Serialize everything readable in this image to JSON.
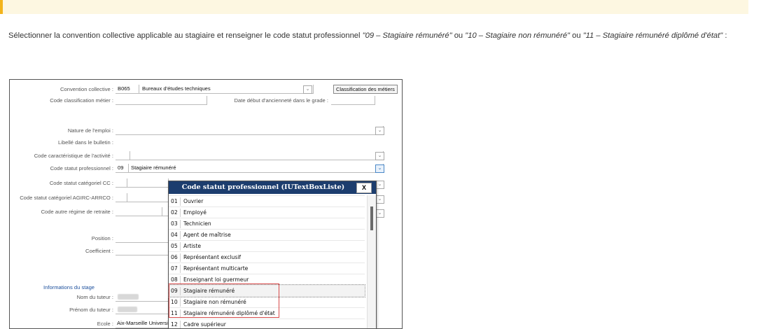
{
  "intro": {
    "part1": "Sélectionner la convention collective applicable au stagiaire et renseigner le code statut professionnel ",
    "q1": "\"09 – Stagiaire rémunéré\"",
    "part2": " ou ",
    "q2": "\"10 – Stagiaire non rémunéré\"",
    "part3": " ou ",
    "q3": "\"11 – Stagiaire rémunéré diplômé d'état\"",
    "part4": " :"
  },
  "form": {
    "convention_label": "Convention collective :",
    "convention_code": "B065",
    "convention_name": "Bureaux d'études techniques",
    "classification_button": "Classification des métiers",
    "code_classification_label": "Code classification métier :",
    "date_debut_label": "Date début d'ancienneté dans le grade :",
    "nature_label": "Nature de l'emploi :",
    "libelle_label": "Libellé dans le bulletin :",
    "code_caracteristique_label": "Code caractéristique de l'activité :",
    "code_statut_label": "Code statut professionnel :",
    "code_statut_code": "09",
    "code_statut_value": "Stagiaire rémunéré",
    "code_statut_cat_label": "Code statut catégoriel CC :",
    "code_statut_agirc_label": "Code statut catégoriel AGIRC-ARRCO :",
    "code_autre_regime_label": "Code autre régime de retraite :",
    "position_label": "Position :",
    "coefficient_label": "Coefficient :",
    "stage_section": "Informations du stage",
    "nom_tuteur_label": "Nom du tuteur :",
    "prenom_tuteur_label": "Prénom du tuteur :",
    "ecole_label": "Ecole :",
    "ecole_value": "Aix-Marseille Universi"
  },
  "popup": {
    "title": "Code statut professionnel (IUTextBoxListe)",
    "close": "X",
    "items": [
      {
        "code": "01",
        "label": "Ouvrier"
      },
      {
        "code": "02",
        "label": "Employé"
      },
      {
        "code": "03",
        "label": "Technicien"
      },
      {
        "code": "04",
        "label": "Agent de maîtrise"
      },
      {
        "code": "05",
        "label": "Artiste"
      },
      {
        "code": "06",
        "label": "Représentant exclusif"
      },
      {
        "code": "07",
        "label": "Représentant multicarte"
      },
      {
        "code": "08",
        "label": "Enseignant loi guermeur"
      },
      {
        "code": "09",
        "label": "Stagiaire rémunéré"
      },
      {
        "code": "10",
        "label": "Stagiaire non rémunéré"
      },
      {
        "code": "11",
        "label": "Stagiaire rémunéré diplômé d'état"
      },
      {
        "code": "12",
        "label": "Cadre supérieur"
      }
    ],
    "selected_code": "09"
  },
  "colors": {
    "note_bg": "#fdf7e1",
    "note_bar": "#f3b41b",
    "popup_header": "#1c3d6e",
    "highlight": "#d84a4a",
    "section_link": "#1c4f9c"
  }
}
